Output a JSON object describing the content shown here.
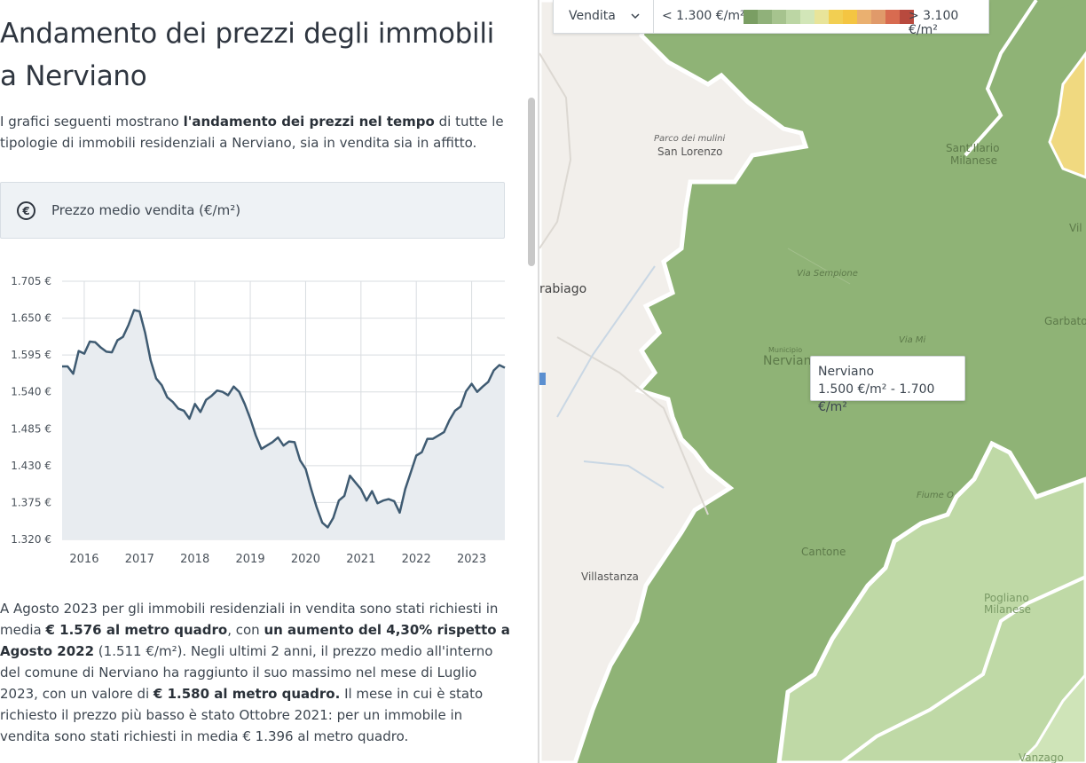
{
  "article": {
    "title": "Andamento dei prezzi degli immobili a Nerviano",
    "intro_before": "I grafici seguenti mostrano ",
    "intro_bold": "l'andamento dei prezzi nel tempo",
    "intro_after": " di tutte le tipologie di immobili residenziali a Nerviano, sia in vendita sia in affitto.",
    "tab_label": "Prezzo medio vendita (€/m²)",
    "tab_icon": "euro-icon",
    "summary_1": "A Agosto 2023 per gli immobili residenziali in vendita sono stati richiesti in media ",
    "summary_b1": "€ 1.576 al metro quadro",
    "summary_2": ", con ",
    "summary_b2": "un aumento del 4,30% rispetto a Agosto 2022",
    "summary_3": " (1.511 €/m²). Negli ultimi 2 anni, il prezzo medio all'interno del comune di Nerviano ha raggiunto il suo massimo nel mese di Luglio 2023, con un valore di ",
    "summary_b3": "€ 1.580 al metro quadro.",
    "summary_4": " Il mese in cui è stato richiesto il prezzo più basso è stato Ottobre 2021: per un immobile in vendita sono stati richiesti in media € 1.396 al metro quadro."
  },
  "chart_data": {
    "type": "area",
    "title": "",
    "xlabel": "",
    "ylabel": "",
    "ylim": [
      1320,
      1705
    ],
    "yticks": [
      1705,
      1650,
      1595,
      1540,
      1485,
      1430,
      1375,
      1320
    ],
    "ytick_labels": [
      "1.705 €",
      "1.650 €",
      "1.595 €",
      "1.540 €",
      "1.485 €",
      "1.430 €",
      "1.375 €",
      "1.320 €"
    ],
    "xlim": [
      2015.6,
      2023.6
    ],
    "xticks": [
      2016,
      2017,
      2018,
      2019,
      2020,
      2021,
      2022,
      2023
    ],
    "xtick_labels": [
      "2016",
      "2017",
      "2018",
      "2019",
      "2020",
      "2021",
      "2022",
      "2023"
    ],
    "grid": true,
    "colors": {
      "line": "#3f5b72",
      "fill": "#e8ecf0",
      "grid": "#d9dde1"
    },
    "x": [
      2015.6,
      2015.7,
      2015.8,
      2015.9,
      2016.0,
      2016.1,
      2016.2,
      2016.3,
      2016.4,
      2016.5,
      2016.6,
      2016.7,
      2016.8,
      2016.9,
      2017.0,
      2017.1,
      2017.2,
      2017.3,
      2017.4,
      2017.5,
      2017.6,
      2017.7,
      2017.8,
      2017.9,
      2018.0,
      2018.1,
      2018.2,
      2018.3,
      2018.4,
      2018.5,
      2018.6,
      2018.7,
      2018.8,
      2018.9,
      2019.0,
      2019.1,
      2019.2,
      2019.3,
      2019.4,
      2019.5,
      2019.6,
      2019.7,
      2019.8,
      2019.9,
      2020.0,
      2020.1,
      2020.2,
      2020.3,
      2020.4,
      2020.5,
      2020.6,
      2020.7,
      2020.8,
      2020.9,
      2021.0,
      2021.1,
      2021.2,
      2021.3,
      2021.4,
      2021.5,
      2021.6,
      2021.7,
      2021.8,
      2021.9,
      2022.0,
      2022.1,
      2022.2,
      2022.3,
      2022.4,
      2022.5,
      2022.6,
      2022.7,
      2022.8,
      2022.9,
      2023.0,
      2023.1,
      2023.2,
      2023.3,
      2023.4,
      2023.5,
      2023.6
    ],
    "values": [
      1578,
      1578,
      1567,
      1601,
      1597,
      1615,
      1614,
      1606,
      1600,
      1599,
      1617,
      1622,
      1640,
      1662,
      1660,
      1628,
      1587,
      1560,
      1550,
      1532,
      1525,
      1515,
      1512,
      1500,
      1522,
      1510,
      1528,
      1534,
      1542,
      1540,
      1535,
      1548,
      1540,
      1522,
      1500,
      1475,
      1455,
      1460,
      1465,
      1472,
      1460,
      1466,
      1465,
      1438,
      1425,
      1395,
      1368,
      1345,
      1338,
      1352,
      1378,
      1385,
      1415,
      1405,
      1395,
      1378,
      1392,
      1374,
      1378,
      1380,
      1377,
      1360,
      1395,
      1420,
      1445,
      1450,
      1470,
      1470,
      1475,
      1480,
      1498,
      1512,
      1518,
      1541,
      1552,
      1540,
      1548,
      1555,
      1572,
      1580,
      1576
    ]
  },
  "map": {
    "legend": {
      "select_value": "Vendita",
      "min_label": "< 1.300 €/m²",
      "max_label": "> 3.100 €/m²",
      "scale_colors": [
        "#7a9e63",
        "#90b17a",
        "#a6c38e",
        "#bcd6a4",
        "#d2e6b8",
        "#e8e49a",
        "#f2cf52",
        "#f4c542",
        "#eab070",
        "#e09a6a",
        "#d86b50",
        "#b84a3e"
      ]
    },
    "places": {
      "parco": "Parco dei mulini",
      "san_lorenzo": "San Lorenzo",
      "santilario": "Sant'Ilario",
      "santilario2": "Milanese",
      "rabiago": "rabiago",
      "via_sempione": "Via Sempione",
      "municipio": "Municipio",
      "nerviano_label": "Nervian",
      "via_m": "Via Mi",
      "villa": "Vil",
      "garbato": "Garbato",
      "villastanza": "Villastanza",
      "cantone": "Cantone",
      "fiume": "Fiume O",
      "pogliano": "Pogliano",
      "pogliano2": "Milanese",
      "vanzago": "Vanzago"
    },
    "tooltip": {
      "name": "Nerviano",
      "range": "1.500 €/m² - 1.700 €/m²"
    }
  }
}
